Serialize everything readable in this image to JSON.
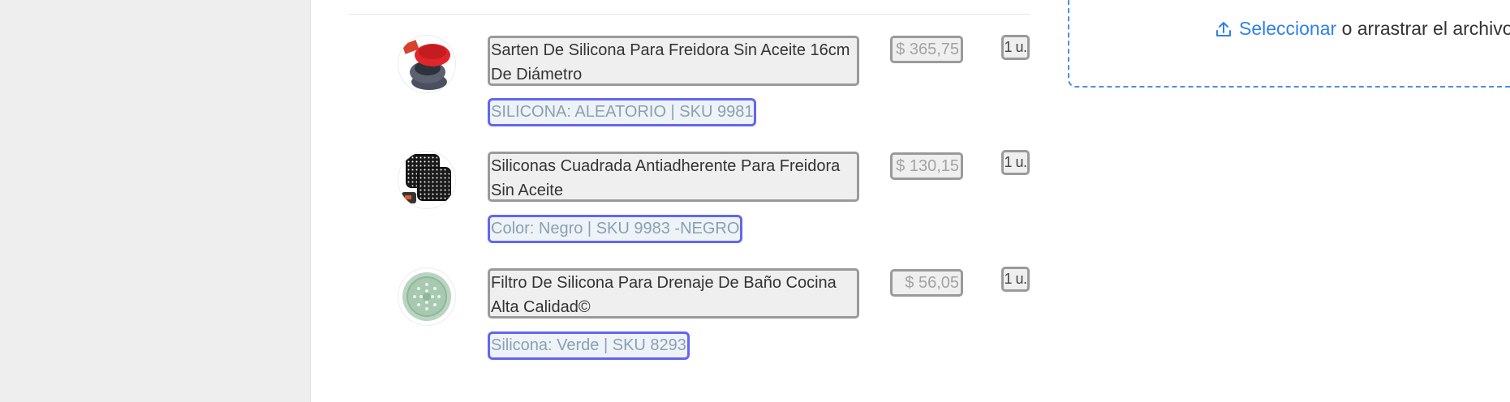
{
  "upload": {
    "link_label": "Seleccionar",
    "rest_label": " o arrastrar el archivo",
    "icon": "upload-icon",
    "accent_color": "#2f80ed",
    "border_color": "#4a90e2"
  },
  "items": [
    {
      "name": "Sarten De Silicona Para Freidora Sin Aceite 16cm De Diámetro",
      "variant": "SILICONA: ALEATORIO | SKU 9981",
      "price": "$ 365,75",
      "qty": "1 u.",
      "image": "red-silicone-pan-thumbnail"
    },
    {
      "name": "Siliconas Cuadrada Antiadherente Para Freidora Sin Aceite",
      "variant": "Color: Negro | SKU 9983 -NEGRO",
      "price": "$ 130,15",
      "qty": "1 u.",
      "image": "black-square-mat-thumbnail"
    },
    {
      "name": "Filtro De Silicona Para Drenaje De Baño Cocina Alta Calidad©",
      "variant": "Silicona: Verde | SKU 8293",
      "price": "$ 56,05",
      "qty": "1 u.",
      "image": "green-drain-filter-thumbnail"
    }
  ],
  "colors": {
    "variant_border": "#6366f1",
    "field_border": "#9a9a9a",
    "field_bg": "#efefef",
    "sidebar_bg": "#eeeeee"
  }
}
